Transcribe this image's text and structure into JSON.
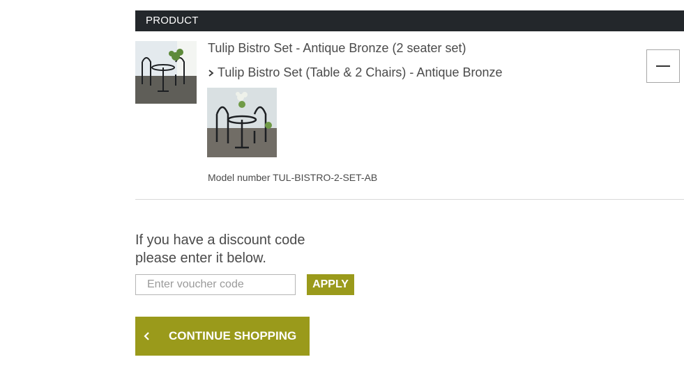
{
  "table": {
    "header_label": "PRODUCT"
  },
  "product": {
    "title": "Tulip Bistro Set - Antique Bronze (2 seater set)",
    "variant": "Tulip Bistro Set (Table & 2 Chairs) - Antique Bronze",
    "model_number": "Model number TUL-BISTRO-2-SET-AB",
    "image_main_icon": "bistro-set-photo",
    "image_variant_icon": "bistro-set-photo"
  },
  "discount": {
    "line1": "If you have a discount code",
    "line2": "please enter it below.",
    "placeholder": "Enter voucher code",
    "apply_label": "APPLY"
  },
  "actions": {
    "continue_label": "CONTINUE SHOPPING"
  },
  "colors": {
    "header_bg": "#23272b",
    "accent": "#9a9a1b"
  }
}
